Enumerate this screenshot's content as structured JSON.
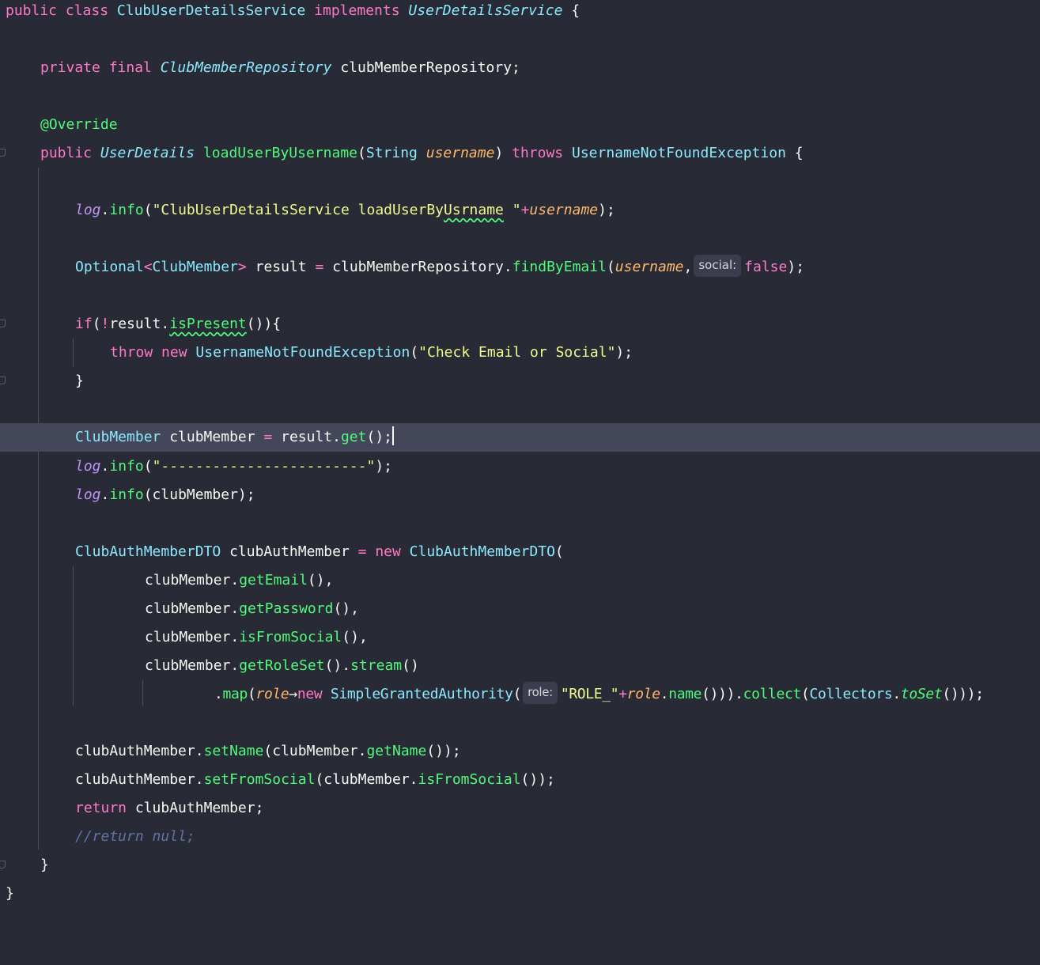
{
  "editor": {
    "colors": {
      "background": "#282a36",
      "current_line": "#44475a",
      "keyword": "#ff79c6",
      "class": "#8be9fd",
      "function": "#50fa7b",
      "string": "#f1fa8c",
      "parameter": "#ffb86c",
      "field": "#bd93f9",
      "comment": "#6272a4"
    },
    "tokens": {
      "l1": [
        "public",
        " ",
        "class",
        " ",
        "ClubUserDetailsService",
        " ",
        "implements",
        " ",
        "UserDetailsService",
        " {"
      ],
      "l3": [
        "private",
        " ",
        "final",
        " ",
        "ClubMemberRepository",
        " clubMemberRepository;"
      ],
      "l5": [
        "@Override"
      ],
      "l6": [
        "public",
        " ",
        "UserDetails",
        " ",
        "loadUserByUsername",
        "(",
        "String",
        " ",
        "username",
        ") ",
        "throws",
        " ",
        "UsernameNotFoundException",
        " {"
      ],
      "l8": [
        "log",
        ".",
        "info",
        "(",
        "\"ClubUserDetailsService loadUserBy",
        "Usrname",
        " \"",
        "+",
        "username",
        ");"
      ],
      "l10": [
        "Optional",
        "<",
        "ClubMember",
        ">",
        " result ",
        "=",
        " clubMemberRepository.",
        "findByEmail",
        "(",
        "username",
        ",",
        "social:",
        "false",
        ");"
      ],
      "l12": [
        "if",
        "(",
        "!",
        "result.",
        "isPresent",
        "()){"
      ],
      "l13": [
        "throw",
        " ",
        "new",
        " ",
        "UsernameNotFoundException",
        "(",
        "\"Check Email or Social\"",
        ");"
      ],
      "l14": [
        "}"
      ],
      "l16": [
        "ClubMember",
        " clubMember ",
        "=",
        " result.",
        "get",
        "();"
      ],
      "l17": [
        "log",
        ".",
        "info",
        "(",
        "\"------------------------\"",
        ");"
      ],
      "l18": [
        "log",
        ".",
        "info",
        "(clubMember);"
      ],
      "l20": [
        "ClubAuthMemberDTO",
        " clubAuthMember ",
        "=",
        " ",
        "new",
        " ",
        "ClubAuthMemberDTO",
        "("
      ],
      "l21": [
        "clubMember.",
        "getEmail",
        "(),"
      ],
      "l22": [
        "clubMember.",
        "getPassword",
        "(),"
      ],
      "l23": [
        "clubMember.",
        "isFromSocial",
        "(),"
      ],
      "l24": [
        "clubMember.",
        "getRoleSet",
        "().",
        "stream",
        "()"
      ],
      "l25": [
        ".",
        "map",
        "(",
        "role",
        "→",
        "new",
        " ",
        "SimpleGrantedAuthority",
        "(",
        "role:",
        "\"ROLE_\"",
        "+",
        "role",
        ".",
        "name",
        "())).",
        "collect",
        "(",
        "Collectors",
        ".",
        "toSet",
        "()));"
      ],
      "l27": [
        "clubAuthMember.",
        "setName",
        "(clubMember.",
        "getName",
        "());"
      ],
      "l28": [
        "clubAuthMember.",
        "setFromSocial",
        "(clubMember.",
        "isFromSocial",
        "());"
      ],
      "l29": [
        "return",
        " clubAuthMember;"
      ],
      "l30": [
        "//return null;"
      ],
      "l31": [
        "}"
      ],
      "l32": [
        "}"
      ]
    }
  }
}
